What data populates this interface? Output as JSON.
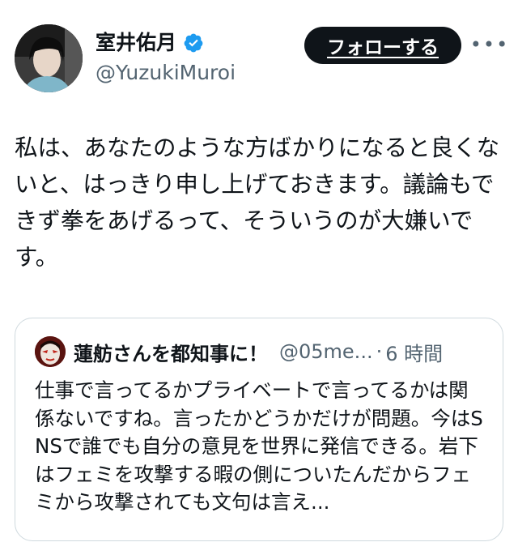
{
  "author": {
    "display_name": "室井佑月",
    "handle": "@YuzukiMuroi",
    "verified": true
  },
  "actions": {
    "follow_label": "フォローする",
    "more_label": "•••"
  },
  "tweet": {
    "text": "私は、あなたのような方ばかりになると良くないと、はっきり申し上げておきます。議論もできず拳をあげるって、そういうのが大嫌いです。"
  },
  "quote": {
    "display_name": "蓮舫さんを都知事に！",
    "handle": "@05me...",
    "separator": "·",
    "time": "6 時間",
    "text": "仕事で言ってるかプライベートで言ってるかは関係ないですね。言ったかどうかだけが問題。今はSNSで誰でも自分の意見を世界に発信できる。岩下はフェミを攻撃する暇の側についたんだからフェミから攻撃されても文句は言え..."
  },
  "colors": {
    "text_primary": "#0f1419",
    "text_secondary": "#536471",
    "verified_blue": "#1d9bf0",
    "border": "#cfd9de",
    "button_bg": "#0f1419"
  },
  "icons": {
    "verified": "verified-badge-icon",
    "more": "more-dots-icon"
  }
}
